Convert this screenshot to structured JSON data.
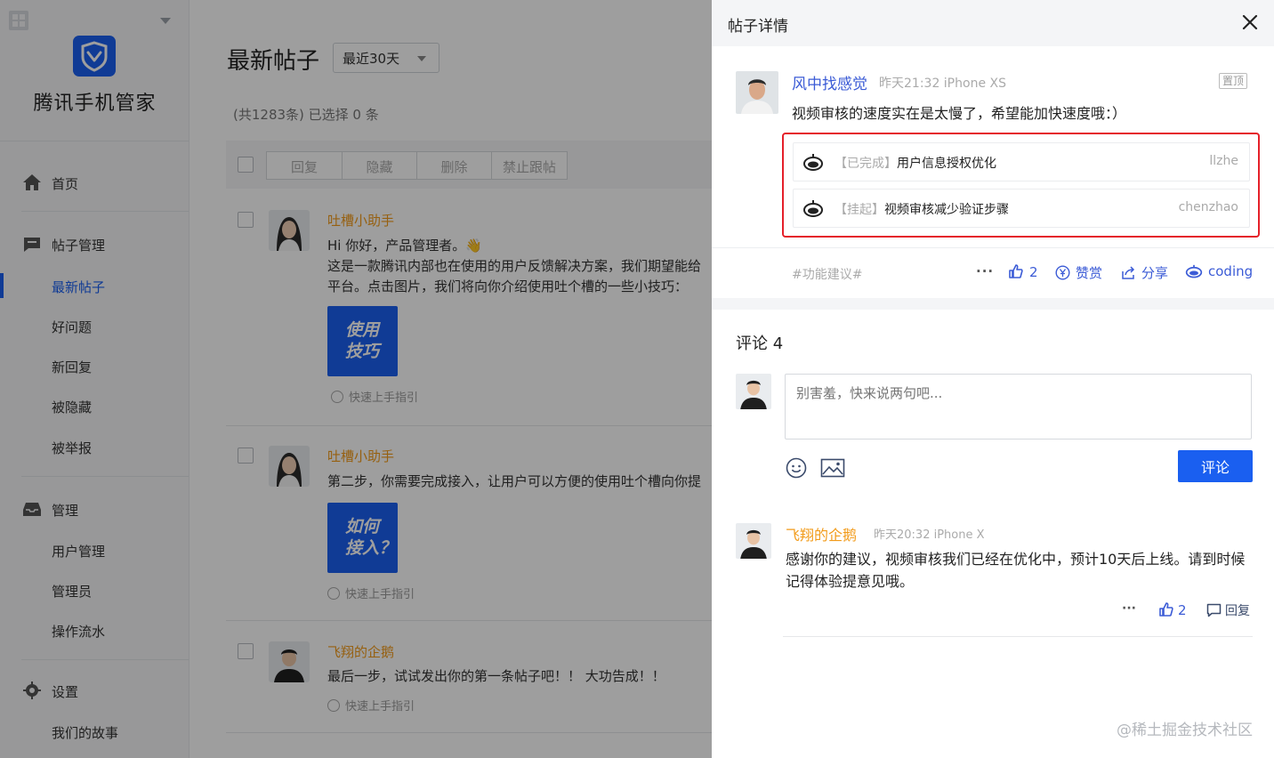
{
  "sidebar": {
    "brand": "腾讯手机管家",
    "items": [
      {
        "label": "首页",
        "icon": "home-icon"
      },
      {
        "label": "帖子管理",
        "icon": "post-icon"
      },
      {
        "label": "最新帖子",
        "active": true
      },
      {
        "label": "好问题"
      },
      {
        "label": "新回复"
      },
      {
        "label": "被隐藏"
      },
      {
        "label": "被举报"
      },
      {
        "label": "管理",
        "icon": "inbox-icon"
      },
      {
        "label": "用户管理"
      },
      {
        "label": "管理员"
      },
      {
        "label": "操作流水"
      },
      {
        "label": "设置",
        "icon": "gear-icon"
      },
      {
        "label": "我们的故事"
      }
    ]
  },
  "main": {
    "title": "最新帖子",
    "range": "最近30天",
    "count_text": "(共1283条) 已选择 0 条",
    "toolbar": [
      "回复",
      "隐藏",
      "删除",
      "禁止跟帖"
    ],
    "posts": [
      {
        "name": "吐槽小助手",
        "lines": [
          "Hi 你好，产品管理者。👋",
          "这是一款腾讯内部也在使用的用户反馈解决方案，我们期望能给",
          "平台。点击图片，我们将向你介绍使用吐个槽的一些小技巧："
        ],
        "guide": [
          "使用",
          "技巧"
        ],
        "meta": "快速上手指引"
      },
      {
        "name": "吐槽小助手",
        "lines": [
          "第二步，你需要完成接入，让用户可以方便的使用吐个槽向你提"
        ],
        "guide": [
          "如何",
          "接入？"
        ],
        "meta": "快速上手指引"
      },
      {
        "name": "飞翔的企鹅",
        "lines": [
          "最后一步，试试发出你的第一条帖子吧！！ 大功告成！！"
        ],
        "meta": "快速上手指引"
      }
    ]
  },
  "drawer": {
    "title": "帖子详情",
    "post": {
      "author": "风中找感觉",
      "time": "昨天21:32 iPhone XS",
      "pin": "置顶",
      "text": "视频审核的速度实在是太慢了，希望能加快速度哦：）",
      "links": [
        {
          "status": "【已完成】",
          "title": "用户信息授权优化",
          "user": "llzhe"
        },
        {
          "status": "【挂起】",
          "title": "视频审核减少验证步骤",
          "user": "chenzhao"
        }
      ],
      "tag": "#功能建议#",
      "actions": {
        "more": "···",
        "likes": "2",
        "reward": "赞赏",
        "share": "分享",
        "coding": "coding"
      }
    },
    "comments": {
      "title": "评论 4",
      "placeholder": "别害羞，快来说两句吧...",
      "submit": "评论",
      "reply": {
        "author": "飞翔的企鹅",
        "time": "昨天20:32 iPhone X",
        "text": "感谢你的建议，视频审核我们已经在优化中，预计10天后上线。请到时候记得体验提意见哦。",
        "more": "···",
        "likes": "2",
        "reply_label": "回复"
      }
    },
    "watermark": "@稀土掘金技术社区"
  },
  "colors": {
    "accent": "#1a5ff0",
    "username": "#f29b1a",
    "link": "#3b5bd6",
    "highlight": "#e5202a"
  }
}
